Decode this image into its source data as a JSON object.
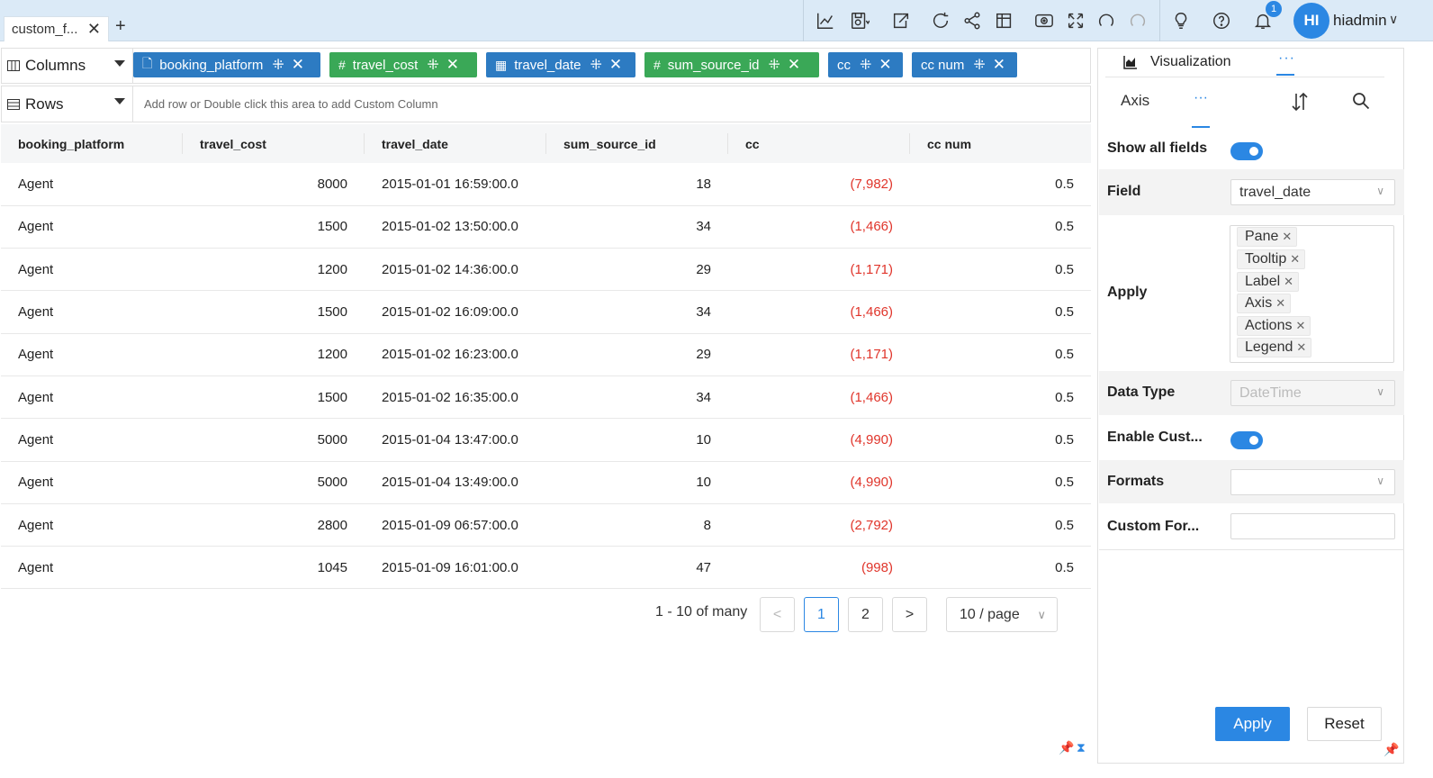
{
  "tabs": [
    {
      "label": "custom_f...",
      "close": "✕"
    }
  ],
  "add_tab": "+",
  "toolbar": {
    "icons": [
      "line-chart-icon",
      "save-icon",
      "export-icon",
      "refresh-icon",
      "share-icon",
      "layout-icon",
      "preview-icon",
      "fullscreen-icon",
      "undo-icon",
      "redo-icon",
      "lightbulb-icon",
      "help-icon",
      "bell-icon"
    ],
    "notification_count": "1",
    "avatar_initials": "HI",
    "username": "hiadmin",
    "user_chevron": "∨"
  },
  "columns_shelf": {
    "label": "Columns",
    "pills": [
      {
        "type_icon": "▯",
        "label": "booking_platform",
        "color": "blue"
      },
      {
        "type_icon": "#",
        "label": "travel_cost",
        "color": "green"
      },
      {
        "type_icon": "▦",
        "label": "travel_date",
        "color": "blue"
      },
      {
        "type_icon": "#",
        "label": "sum_source_id",
        "color": "green"
      },
      {
        "type_icon": "",
        "label": "cc",
        "color": "blue"
      },
      {
        "type_icon": "",
        "label": "cc num",
        "color": "blue"
      }
    ]
  },
  "rows_shelf": {
    "label": "Rows",
    "hint": "Add row or Double click this area to add Custom Column"
  },
  "table": {
    "headers": [
      "booking_platform",
      "travel_cost",
      "travel_date",
      "sum_source_id",
      "cc",
      "cc num"
    ],
    "rows": [
      [
        "Agent",
        "8000",
        "2015-01-01 16:59:00.0",
        "18",
        "(7,982)",
        "0.5"
      ],
      [
        "Agent",
        "1500",
        "2015-01-02 13:50:00.0",
        "34",
        "(1,466)",
        "0.5"
      ],
      [
        "Agent",
        "1200",
        "2015-01-02 14:36:00.0",
        "29",
        "(1,171)",
        "0.5"
      ],
      [
        "Agent",
        "1500",
        "2015-01-02 16:09:00.0",
        "34",
        "(1,466)",
        "0.5"
      ],
      [
        "Agent",
        "1200",
        "2015-01-02 16:23:00.0",
        "29",
        "(1,171)",
        "0.5"
      ],
      [
        "Agent",
        "1500",
        "2015-01-02 16:35:00.0",
        "34",
        "(1,466)",
        "0.5"
      ],
      [
        "Agent",
        "5000",
        "2015-01-04 13:47:00.0",
        "10",
        "(4,990)",
        "0.5"
      ],
      [
        "Agent",
        "5000",
        "2015-01-04 13:49:00.0",
        "10",
        "(4,990)",
        "0.5"
      ],
      [
        "Agent",
        "2800",
        "2015-01-09 06:57:00.0",
        "8",
        "(2,792)",
        "0.5"
      ],
      [
        "Agent",
        "1045",
        "2015-01-09 16:01:00.0",
        "47",
        "(998)",
        "0.5"
      ]
    ]
  },
  "pagination": {
    "info": "1 - 10 of many",
    "prev": "<",
    "pages": [
      "1",
      "2"
    ],
    "current": "1",
    "next": ">",
    "page_size": "10 / page"
  },
  "right_panel": {
    "viz_tab": "Visualization",
    "viz_more": "···",
    "axis_tab": "Axis",
    "axis_more": "···",
    "show_all_fields_label": "Show all fields",
    "show_all_fields": true,
    "field_label": "Field",
    "field_value": "travel_date",
    "apply_label": "Apply",
    "apply_chips": [
      "Pane",
      "Tooltip",
      "Label",
      "Axis",
      "Actions",
      "Legend"
    ],
    "data_type_label": "Data Type",
    "data_type_value": "DateTime",
    "enable_custom_label": "Enable Cust...",
    "enable_custom": true,
    "formats_label": "Formats",
    "formats_value": "",
    "custom_format_label": "Custom For...",
    "custom_format_value": "",
    "apply_button": "Apply",
    "reset_button": "Reset"
  },
  "colors": {
    "accent": "#2b87e3",
    "pill_blue": "#2d7bc2",
    "pill_green": "#3aa857",
    "negative": "#e0352b"
  }
}
